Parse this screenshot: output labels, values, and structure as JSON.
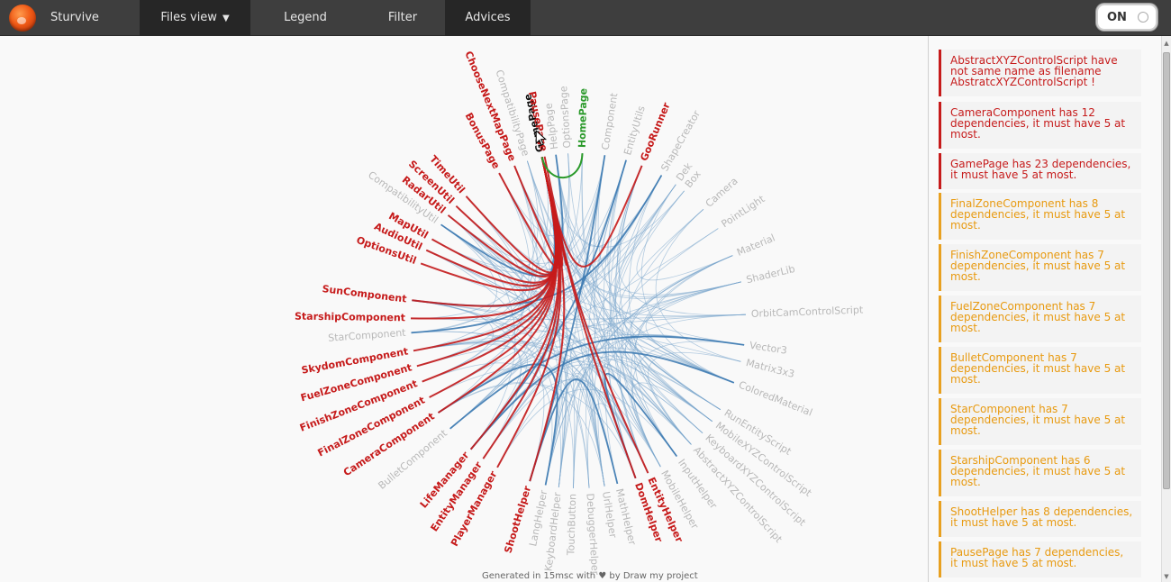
{
  "header": {
    "brand": "Sturvive",
    "nav": [
      {
        "label": "Files view",
        "caret": "▼"
      },
      {
        "label": "Legend"
      },
      {
        "label": "Filter"
      },
      {
        "label": "Advices"
      }
    ],
    "toggle_label": "ON"
  },
  "footer": {
    "text": "Generated in 15msc with ♥ by Draw my project"
  },
  "colors": {
    "error": "#c61b1b",
    "warning": "#e89a10",
    "edge_blue": "#3a78b0",
    "selected_green": "#2b9a2b",
    "inactive_label": "#b8b8b8"
  },
  "diagram": {
    "selected": "GamePage",
    "nodes": [
      {
        "name": "GamePage",
        "angle": -12.5,
        "status": "selected"
      },
      {
        "name": "HelpPage",
        "angle": -7.7,
        "status": "inactive"
      },
      {
        "name": "OptionsPage",
        "angle": -3.5,
        "status": "inactive"
      },
      {
        "name": "HomePage",
        "angle": 1.4,
        "status": "ok"
      },
      {
        "name": "Component",
        "angle": 9.1,
        "status": "inactive"
      },
      {
        "name": "EntityUtils",
        "angle": 16.6,
        "status": "inactive"
      },
      {
        "name": "GooRunner",
        "angle": 22.3,
        "status": "error"
      },
      {
        "name": "ShapeCreator",
        "angle": 29.8,
        "status": "inactive"
      },
      {
        "name": "Dek",
        "angle": 35.6,
        "status": "inactive"
      },
      {
        "name": "Box",
        "angle": 39.2,
        "status": "inactive"
      },
      {
        "name": "Camera",
        "angle": 48.3,
        "status": "inactive"
      },
      {
        "name": "PointLight",
        "angle": 56.6,
        "status": "inactive"
      },
      {
        "name": "Material",
        "angle": 67.1,
        "status": "inactive"
      },
      {
        "name": "ShaderLib",
        "angle": 76.6,
        "status": "inactive"
      },
      {
        "name": "OrbitCamControlScript",
        "angle": 87.9,
        "status": "inactive"
      },
      {
        "name": "Vector3",
        "angle": 98.3,
        "status": "inactive"
      },
      {
        "name": "Matrix3x3",
        "angle": 104.1,
        "status": "inactive"
      },
      {
        "name": "ColoredMaterial",
        "angle": 111.7,
        "status": "inactive"
      },
      {
        "name": "RunEntityScript",
        "angle": 122.0,
        "status": "inactive"
      },
      {
        "name": "MobileXYZControlScript",
        "angle": 126.9,
        "status": "inactive"
      },
      {
        "name": "KeyboardXYZControlScript",
        "angle": 132.1,
        "status": "inactive"
      },
      {
        "name": "AbstractXYZControlScript",
        "angle": 137.6,
        "status": "inactive"
      },
      {
        "name": "InputHelper",
        "angle": 144.0,
        "status": "inactive"
      },
      {
        "name": "MobileHelper",
        "angle": 150.6,
        "status": "inactive"
      },
      {
        "name": "EntityHelper",
        "angle": 155.4,
        "status": "error"
      },
      {
        "name": "DomHelper",
        "angle": 160.0,
        "status": "error"
      },
      {
        "name": "MathHelper",
        "angle": 166.5,
        "status": "inactive"
      },
      {
        "name": "UrlHelper",
        "angle": 171.0,
        "status": "inactive"
      },
      {
        "name": "DebuggerHelper",
        "angle": 176.3,
        "status": "inactive"
      },
      {
        "name": "TouchButton",
        "angle": 181.7,
        "status": "inactive"
      },
      {
        "name": "KeyboardHelper",
        "angle": 186.7,
        "status": "inactive"
      },
      {
        "name": "LangHelper",
        "angle": 191.3,
        "status": "inactive"
      },
      {
        "name": "ShootHelper",
        "angle": 196.8,
        "status": "error"
      },
      {
        "name": "PlayerManager",
        "angle": 208.9,
        "status": "error"
      },
      {
        "name": "EntityManager",
        "angle": 214.6,
        "status": "error"
      },
      {
        "name": "LifeManager",
        "angle": 219.9,
        "status": "error"
      },
      {
        "name": "BulletComponent",
        "angle": 229.9,
        "status": "inactive"
      },
      {
        "name": "CameraComponent",
        "angle": 236.7,
        "status": "error"
      },
      {
        "name": "FinalZoneComponent",
        "angle": 242.8,
        "status": "error"
      },
      {
        "name": "FinishZoneComponent",
        "angle": 248.7,
        "status": "error"
      },
      {
        "name": "FuelZoneComponent",
        "angle": 254.3,
        "status": "error"
      },
      {
        "name": "SkydomComponent",
        "angle": 259.7,
        "status": "error"
      },
      {
        "name": "StarComponent",
        "angle": 265.9,
        "status": "inactive"
      },
      {
        "name": "StarshipComponent",
        "angle": 270.8,
        "status": "error"
      },
      {
        "name": "SunComponent",
        "angle": 277.0,
        "status": "error"
      },
      {
        "name": "OptionsUtil",
        "angle": 290.0,
        "status": "error"
      },
      {
        "name": "AudioUtil",
        "angle": 294.9,
        "status": "error"
      },
      {
        "name": "MapUtil",
        "angle": 299.1,
        "status": "error"
      },
      {
        "name": "CompatibilityUtil",
        "angle": 305.0,
        "status": "inactive"
      },
      {
        "name": "RadarUtil",
        "angle": 309.0,
        "status": "error"
      },
      {
        "name": "ScreenUtil",
        "angle": 313.2,
        "status": "error"
      },
      {
        "name": "TimeUtil",
        "angle": 318.0,
        "status": "error"
      },
      {
        "name": "BonusPage",
        "angle": 331.8,
        "status": "error"
      },
      {
        "name": "ChooseNextMapPage",
        "angle": 337.6,
        "status": "error"
      },
      {
        "name": "CompatibilityPage",
        "angle": 342.3,
        "status": "inactive"
      },
      {
        "name": "PausePage",
        "angle": 348.4,
        "status": "error"
      }
    ]
  },
  "advices": [
    {
      "level": "error",
      "text": "AbstractXYZControlScript have not same name as filename AbstratcXYZControlScript !"
    },
    {
      "level": "error",
      "text": "CameraComponent has 12 dependencies, it must have 5 at most."
    },
    {
      "level": "error",
      "text": "GamePage has 23 dependencies, it must have 5 at most."
    },
    {
      "level": "warning",
      "text": "FinalZoneComponent has 8 dependencies, it must have 5 at most."
    },
    {
      "level": "warning",
      "text": "FinishZoneComponent has 7 dependencies, it must have 5 at most."
    },
    {
      "level": "warning",
      "text": "FuelZoneComponent has 7 dependencies, it must have 5 at most."
    },
    {
      "level": "warning",
      "text": "BulletComponent has 7 dependencies, it must have 5 at most."
    },
    {
      "level": "warning",
      "text": "StarComponent has 7 dependencies, it must have 5 at most."
    },
    {
      "level": "warning",
      "text": "StarshipComponent has 6 dependencies, it must have 5 at most."
    },
    {
      "level": "warning",
      "text": "ShootHelper has 8 dependencies, it must have 5 at most."
    },
    {
      "level": "warning",
      "text": "PausePage has 7 dependencies, it must have 5 at most."
    }
  ]
}
